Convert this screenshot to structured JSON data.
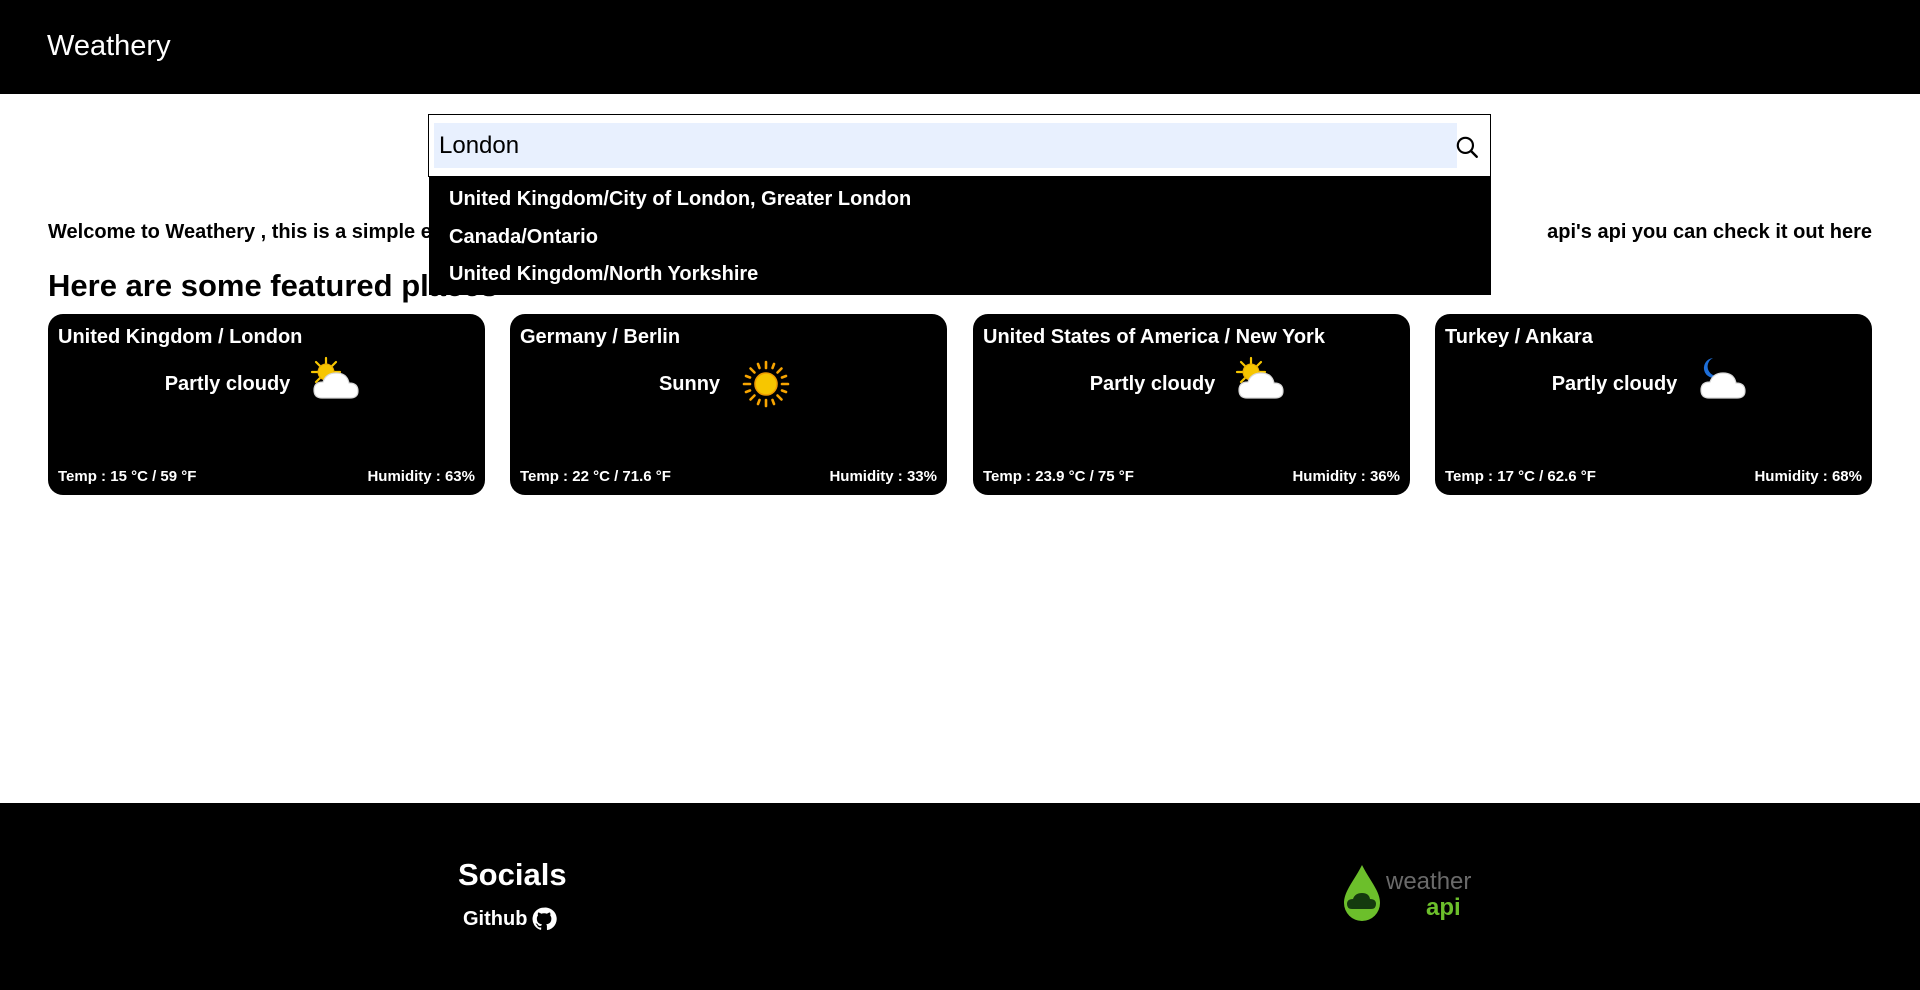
{
  "header": {
    "brand": "Weathery"
  },
  "search": {
    "value": "London",
    "suggestions": [
      "United Kingdom/City of London, Greater London",
      "Canada/Ontario",
      "United Kingdom/North Yorkshire"
    ]
  },
  "intro": {
    "welcome_start": "Welcome to Weathery , this is a simple ej",
    "welcome_end": "api's api you can check it out here",
    "featured_title": "Here are some featured places"
  },
  "cards": [
    {
      "location": "United Kingdom / London",
      "condition": "Partly cloudy",
      "icon": "partly-cloudy-day-icon",
      "temp": "Temp : 15 °C / 59 °F",
      "humidity": "Humidity : 63%"
    },
    {
      "location": "Germany / Berlin",
      "condition": "Sunny",
      "icon": "sunny-icon",
      "temp": "Temp : 22 °C / 71.6 °F",
      "humidity": "Humidity : 33%"
    },
    {
      "location": "United States of America / New York",
      "condition": "Partly cloudy",
      "icon": "partly-cloudy-day-icon",
      "temp": "Temp : 23.9 °C / 75 °F",
      "humidity": "Humidity : 36%"
    },
    {
      "location": "Turkey / Ankara",
      "condition": "Partly cloudy",
      "icon": "partly-cloudy-night-icon",
      "temp": "Temp : 17 °C / 62.6 °F",
      "humidity": "Humidity : 68%"
    }
  ],
  "footer": {
    "socials_title": "Socials",
    "github_label": "Github",
    "logo_text_1": "weather",
    "logo_text_2": "api"
  },
  "colors": {
    "bar_background": "#000000",
    "input_highlight": "#e8f0fe",
    "logo_green": "#6cbf2b",
    "sun_yellow": "#f7c600",
    "moon_blue": "#1e6fd9"
  }
}
